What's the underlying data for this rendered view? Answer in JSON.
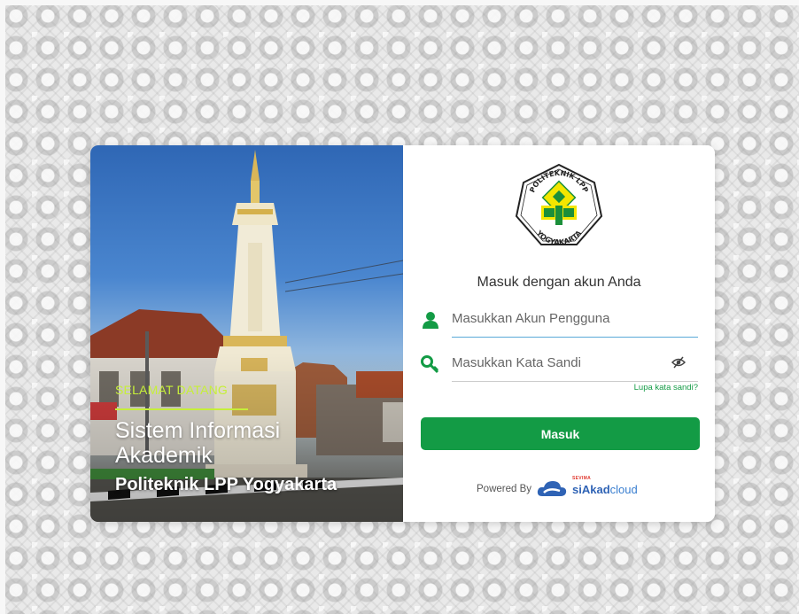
{
  "hero": {
    "welcome": "SELAMAT DATANG",
    "title": "Sistem Informasi\nAkademik",
    "institution": "Politeknik LPP Yogyakarta"
  },
  "logo": {
    "text_top": "POLITEKNIK LPP",
    "text_bottom": "YOGYAKARTA"
  },
  "form": {
    "heading": "Masuk dengan akun Anda",
    "username_placeholder": "Masukkan Akun Pengguna",
    "password_placeholder": "Masukkan Kata Sandi",
    "forgot_link": "Lupa kata sandi?",
    "submit_label": "Masuk"
  },
  "footer": {
    "powered_by": "Powered By",
    "brand_prefix": "siAkad",
    "brand_suffix": "cloud",
    "brand_sub": "SEVIMA"
  },
  "colors": {
    "accent_green": "#139b45",
    "welcome_lime": "#c6ef39",
    "brand_blue": "#2f63b5"
  },
  "icons": [
    "user-icon",
    "key-icon",
    "eye-slash-icon",
    "cloud-logo-icon"
  ]
}
